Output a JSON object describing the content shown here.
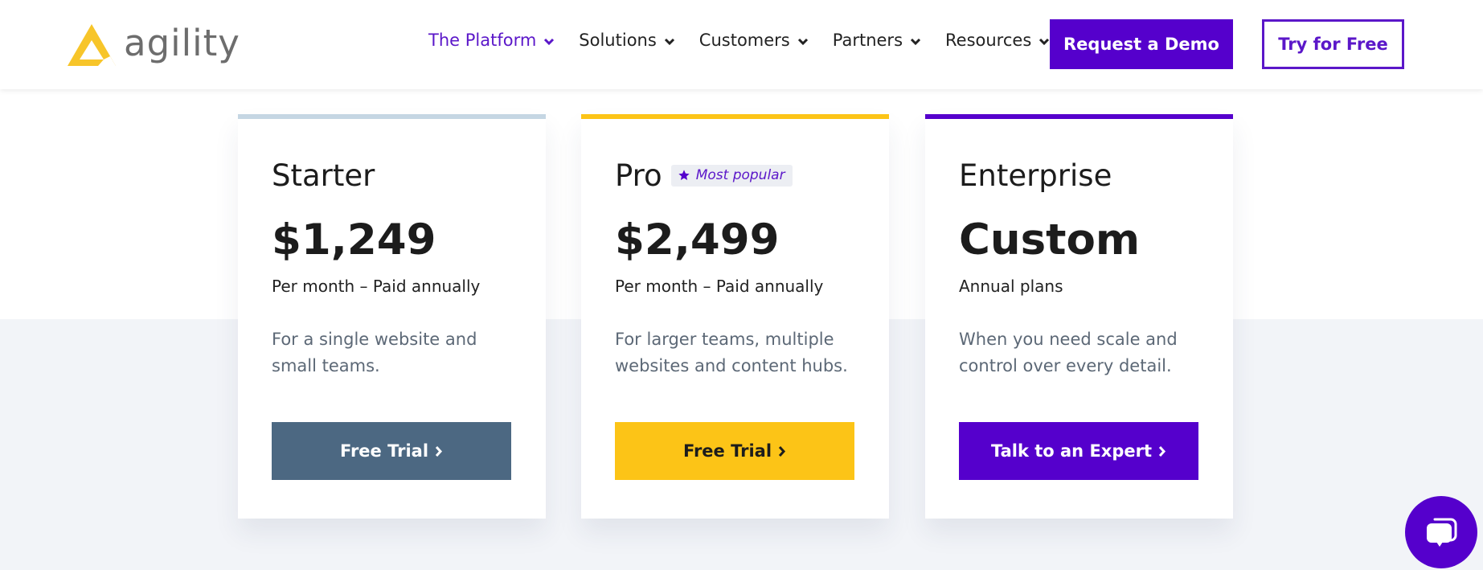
{
  "brand": {
    "name": "agility",
    "logo_color": "#f7c52a",
    "accent": "#5500cc"
  },
  "nav": {
    "items": [
      {
        "label": "The Platform",
        "active": true
      },
      {
        "label": "Solutions",
        "active": false
      },
      {
        "label": "Customers",
        "active": false
      },
      {
        "label": "Partners",
        "active": false
      },
      {
        "label": "Resources",
        "active": false
      }
    ],
    "request_demo_label": "Request a Demo",
    "try_free_label": "Try for Free"
  },
  "plans": [
    {
      "name": "Starter",
      "badge": null,
      "price": "$1,249",
      "period": "Per month – Paid annually",
      "description": "For a single website and small teams.",
      "cta_label": "Free Trial",
      "bar_color": "#c5d6e3",
      "cta_bg": "#4c6882",
      "cta_fg": "#ffffff"
    },
    {
      "name": "Pro",
      "badge": "Most popular",
      "badge_icon": "star-icon",
      "price": "$2,499",
      "period": "Per month – Paid annually",
      "description": "For larger teams, multiple websites and content hubs.",
      "cta_label": "Free Trial",
      "bar_color": "#fcc417",
      "cta_bg": "#fcc417",
      "cta_fg": "#1c1c1c"
    },
    {
      "name": "Enterprise",
      "badge": null,
      "price": "Custom",
      "period": "Annual plans",
      "description": "When you need scale and control over every detail.",
      "cta_label": "Talk to an Expert",
      "bar_color": "#5500cc",
      "cta_bg": "#5500cc",
      "cta_fg": "#ffffff"
    }
  ],
  "chat": {
    "icon": "chat-bubbles-icon"
  }
}
